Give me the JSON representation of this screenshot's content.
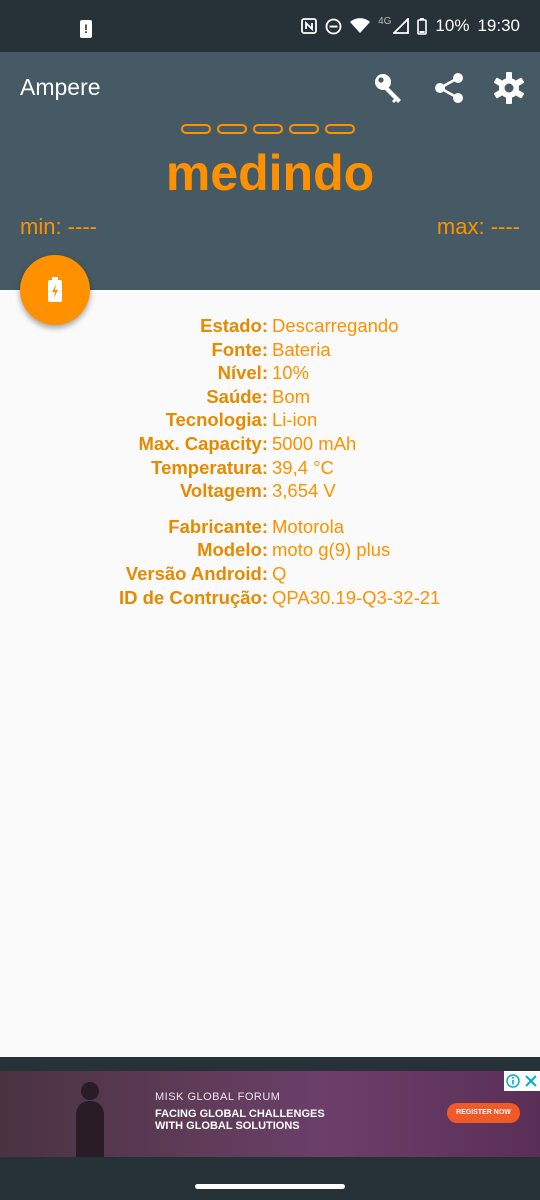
{
  "status_bar": {
    "battery_percent": "10%",
    "time": "19:30",
    "network": "4G"
  },
  "app_bar": {
    "title": "Ampere",
    "status": "medindo",
    "min_label": "min: ----",
    "max_label": "max: ----"
  },
  "icons": {
    "key": "key-icon",
    "share": "share-icon",
    "settings": "gear-icon",
    "fab": "battery-charging-icon"
  },
  "battery_info": [
    {
      "label": "Estado:",
      "value": "Descarregando"
    },
    {
      "label": "Fonte:",
      "value": "Bateria"
    },
    {
      "label": "Nível:",
      "value": "10%"
    },
    {
      "label": "Saúde:",
      "value": "Bom"
    },
    {
      "label": "Tecnologia:",
      "value": "Li-ion"
    },
    {
      "label": "Max. Capacity:",
      "value": "5000 mAh"
    },
    {
      "label": "Temperatura:",
      "value": "39,4 °C"
    },
    {
      "label": "Voltagem:",
      "value": "3,654 V"
    }
  ],
  "device_info": [
    {
      "label": "Fabricante:",
      "value": "Motorola"
    },
    {
      "label": "Modelo:",
      "value": "moto g(9) plus"
    },
    {
      "label": "Versão Android:",
      "value": "Q"
    },
    {
      "label": "ID de Contrução:",
      "value": "QPA30.19-Q3-32-21"
    }
  ],
  "ad": {
    "line1": "MISK GLOBAL FORUM",
    "line2": "FACING GLOBAL  CHALLENGES",
    "line3": "WITH GLOBAL SOLUTIONS",
    "cta": "REGISTER NOW"
  },
  "colors": {
    "accent": "#ff9100",
    "toolbar": "#455a64",
    "status_bar": "#263238",
    "background": "#fafafa"
  }
}
